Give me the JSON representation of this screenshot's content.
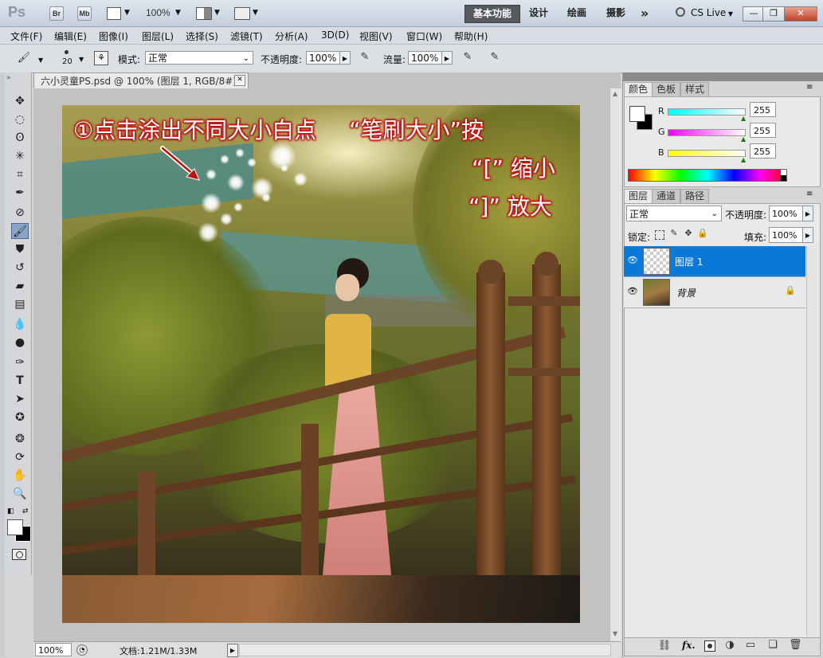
{
  "titlebar": {
    "app_logo": "Ps",
    "bridge_btn": "Br",
    "minibridge_btn": "Mb",
    "zoom_select": "100%",
    "workspaces": [
      "基本功能",
      "设计",
      "绘画",
      "摄影"
    ],
    "more_glyph": "»",
    "cslive": "CS Live"
  },
  "menu": {
    "items": [
      "文件(F)",
      "编辑(E)",
      "图像(I)",
      "图层(L)",
      "选择(S)",
      "滤镜(T)",
      "分析(A)",
      "3D(D)",
      "视图(V)",
      "窗口(W)",
      "帮助(H)"
    ]
  },
  "options": {
    "brush_size": "20",
    "mode_label": "模式:",
    "mode_value": "正常",
    "opacity_label": "不透明度:",
    "opacity_value": "100%",
    "flow_label": "流量:",
    "flow_value": "100%"
  },
  "document": {
    "tab_title": "六小灵童PS.psd @ 100% (图层 1, RGB/8#) *",
    "zoom": "100%",
    "doc_info": "文档:1.21M/1.33M"
  },
  "canvas": {
    "note1": "①点击涂出不同大小白点",
    "note2": "“笔刷大小”按",
    "note3": "“[” 缩小",
    "note4": "“]” 放大"
  },
  "color_panel": {
    "tabs": [
      "颜色",
      "色板",
      "样式"
    ],
    "r_label": "R",
    "g_label": "G",
    "b_label": "B",
    "r_value": "255",
    "g_value": "255",
    "b_value": "255"
  },
  "layers_panel": {
    "tabs": [
      "图层",
      "通道",
      "路径"
    ],
    "blend_mode": "正常",
    "opacity_label": "不透明度:",
    "opacity_value": "100%",
    "lock_label": "锁定:",
    "fill_label": "填充:",
    "fill_value": "100%",
    "layers": [
      {
        "name": "图层 1",
        "selected": true
      },
      {
        "name": "背景",
        "locked": true
      }
    ],
    "footer_fx": "fx."
  },
  "colors": {
    "accent_selected_layer": "#0a78d7",
    "annotation_outline": "#c01010"
  }
}
